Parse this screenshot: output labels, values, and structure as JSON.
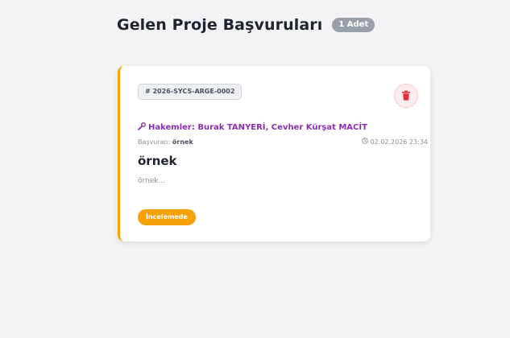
{
  "header": {
    "title": "Gelen Proje Başvuruları",
    "count_badge": "1 Adet"
  },
  "card": {
    "reference_id": "# 2026-SYCS-ARGE-0002",
    "reviewers": "Hakemler: Burak TANYERİ, Cevher Kürşat MACİT",
    "applicant_label": "Başvuran:",
    "applicant_name": "örnek",
    "timestamp": "02.02.2026 23:34",
    "project_title": "örnek",
    "project_description": "örnek...",
    "status": "İncelemede",
    "icons": {
      "delete": "trash-icon",
      "reviewers": "wrench-icon",
      "timestamp": "clock-icon"
    }
  },
  "colors": {
    "accent": "#f5a10a",
    "reviewers": "#8b2fb0",
    "delete": "#e0303a"
  }
}
